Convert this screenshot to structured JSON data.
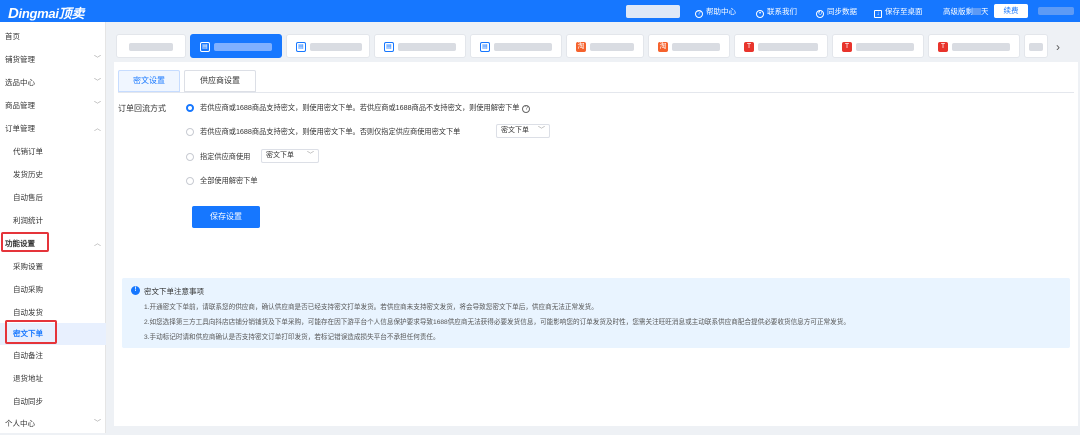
{
  "app": {
    "logo_mark": "D",
    "logo_rest": "ingmai",
    "logo_cn": "顶卖"
  },
  "topbar": {
    "help": "帮助中心",
    "contact": "联系我们",
    "sync": "同步数据",
    "save_desktop": "保存至桌面",
    "version": "高级版剩",
    "version_suffix": "天",
    "renew": "续费"
  },
  "sidebar": {
    "home": "首页",
    "distribution": "铺货管理",
    "product_select": "选品中心",
    "product_manage": "商品管理",
    "order_manage": "订单管理",
    "order_sub": [
      "代销订单",
      "发货历史",
      "自动售后",
      "利润统计"
    ],
    "feature_settings": "功能设置",
    "feature_sub": [
      "采购设置",
      "自动采购",
      "自动发货",
      "密文下单",
      "自动备注",
      "退货地址",
      "自动同步"
    ],
    "personal": "个人中心"
  },
  "subtabs": {
    "cipher": "密文设置",
    "supplier": "供应商设置"
  },
  "form": {
    "label": "订单回流方式",
    "opt1": "若供应商或1688商品支持密文，则使用密文下单。若供应商或1688商品不支持密文，则使用解密下单",
    "opt2": "若供应商或1688商品支持密文，则使用密文下单。否则仅指定供应商使用密文下单",
    "opt2_select": "密文下单",
    "opt3": "指定供应商使用",
    "opt3_select": "密文下单",
    "opt4": "全部使用解密下单",
    "help_glyph": "?",
    "save": "保存设置"
  },
  "notice": {
    "title": "密文下单注意事项",
    "lines": [
      "1.开通密文下单前，请联系您的供应商，确认供应商是否已经支持密文打单发货。若供应商未支持密文发货，将会导致您密文下单后，供应商无法正常发货。",
      "2.如您选择第三方工具向抖店店铺分销铺货及下单采购，可能存在因下游平台个人信息保护要求导致1688供应商无法获得必要发货信息，可能影响您的订单发货及时性，您需关注旺旺消息或主动联系供应商配合提供必要收货信息方可正常发货。",
      "3.手动标记时请和供应商确认是否支持密文订单打印发货，若标记错误造成损失平台不承担任何责任。"
    ]
  },
  "icons": {
    "shop_tab_icons": [
      "blank",
      "doc-icon",
      "doc-icon",
      "doc-icon",
      "doc-icon",
      "taobao-icon",
      "taobao-icon",
      "tmall-icon",
      "tmall-icon",
      "tmall-icon",
      "blank"
    ]
  },
  "colors": {
    "brand": "#1677ff",
    "highlight": "#e5343a"
  }
}
